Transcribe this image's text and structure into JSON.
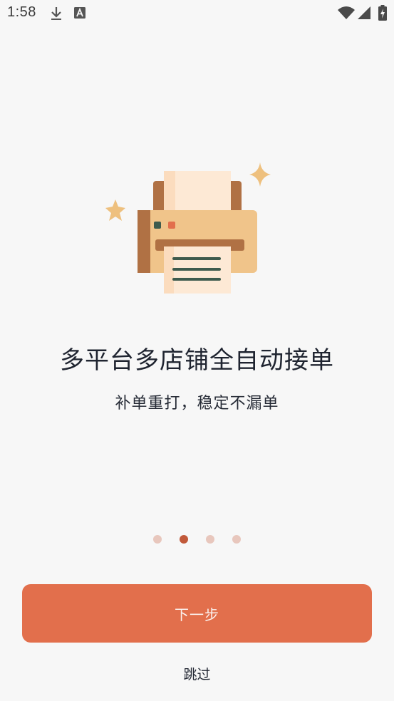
{
  "status_bar": {
    "time": "1:58",
    "icons": [
      "download-icon",
      "font-a-icon",
      "wifi-icon",
      "signal-icon",
      "battery-charging-icon"
    ]
  },
  "illustration": {
    "icon": "printer-icon",
    "colors": {
      "body": "#f0c48a",
      "body_shadow": "#b07144",
      "paper": "#fde9d5",
      "lines": "#3e5b4d",
      "sparkle": "#eec07e",
      "red_button": "#e26f4c",
      "green_button": "#3e5b4d"
    }
  },
  "main": {
    "title": "多平台多店铺全自动接单",
    "subtitle": "补单重打，稳定不漏单"
  },
  "pager": {
    "total": 4,
    "active_index": 1
  },
  "actions": {
    "next_label": "下一步",
    "skip_label": "跳过"
  },
  "colors": {
    "accent": "#e26f4c",
    "dot_active": "#c1593a",
    "dot_inactive": "#e8c7bd",
    "background": "#f7f7f7"
  }
}
